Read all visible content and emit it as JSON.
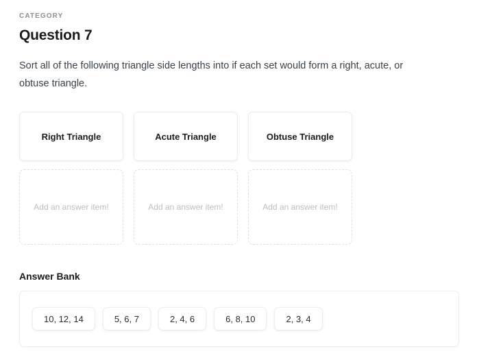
{
  "header": {
    "category_label": "CATEGORY",
    "question_title": "Question 7",
    "prompt": "Sort all of the following triangle side lengths into if each set would form a right, acute, or obtuse triangle."
  },
  "columns": [
    {
      "card_label": "Right Triangle",
      "drop_placeholder": "Add an answer item!"
    },
    {
      "card_label": "Acute Triangle",
      "drop_placeholder": "Add an answer item!"
    },
    {
      "card_label": "Obtuse Triangle",
      "drop_placeholder": "Add an answer item!"
    }
  ],
  "answer_bank": {
    "heading": "Answer Bank",
    "items": [
      {
        "label": "10, 12, 14"
      },
      {
        "label": "5, 6, 7"
      },
      {
        "label": "2, 4, 6"
      },
      {
        "label": "6, 8, 10"
      },
      {
        "label": "2, 3, 4"
      }
    ]
  },
  "colors": {
    "page_background": "#ffffff",
    "title_text": "#1b1b1b",
    "body_text": "#37414a",
    "muted_label": "#8a8f94",
    "placeholder_text": "#bdbdbd",
    "card_border": "#ececec",
    "dropzone_border": "#e0e0e0"
  }
}
